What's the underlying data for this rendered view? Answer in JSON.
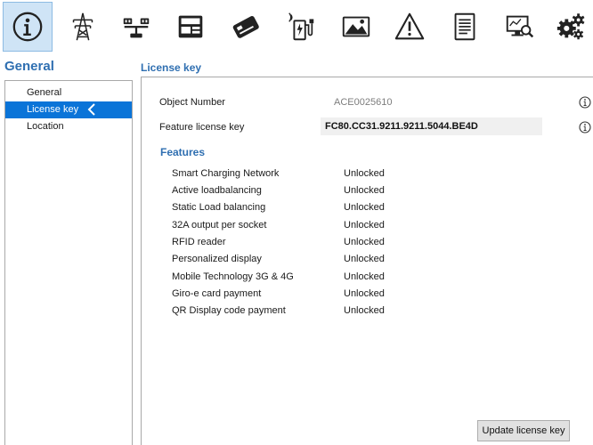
{
  "toolbar": {
    "items": [
      {
        "icon": "info-circle-icon",
        "active": true
      },
      {
        "icon": "power-tower-icon"
      },
      {
        "icon": "load-balance-icon"
      },
      {
        "icon": "card-payment-icon"
      },
      {
        "icon": "rfid-card-icon"
      },
      {
        "icon": "charging-station-icon"
      },
      {
        "icon": "display-image-icon"
      },
      {
        "icon": "warning-icon"
      },
      {
        "icon": "document-icon"
      },
      {
        "icon": "diagnostics-monitor-icon"
      },
      {
        "icon": "settings-gears-icon"
      }
    ]
  },
  "sidebar": {
    "title": "General",
    "items": [
      {
        "label": "General"
      },
      {
        "label": "License key",
        "selected": true
      },
      {
        "label": "Location"
      }
    ]
  },
  "panel": {
    "title": "License key",
    "object_number_label": "Object Number",
    "object_number_value": "ACE0025610",
    "feature_key_label": "Feature license key",
    "feature_key_value": "FC80.CC31.9211.9211.5044.BE4D",
    "features_title": "Features",
    "features": [
      {
        "name": "Smart Charging Network",
        "status": "Unlocked"
      },
      {
        "name": "Active loadbalancing",
        "status": "Unlocked"
      },
      {
        "name": "Static Load balancing",
        "status": "Unlocked"
      },
      {
        "name": "32A output per socket",
        "status": "Unlocked"
      },
      {
        "name": "RFID reader",
        "status": "Unlocked"
      },
      {
        "name": "Personalized display",
        "status": "Unlocked"
      },
      {
        "name": "Mobile Technology 3G & 4G",
        "status": "Unlocked"
      },
      {
        "name": "Giro-e card payment",
        "status": "Unlocked"
      },
      {
        "name": "QR Display code payment",
        "status": "Unlocked"
      }
    ],
    "update_button": "Update license key"
  },
  "colors": {
    "accent": "#2f6fb1",
    "selection": "#0a74d8",
    "active_tool_bg": "#cfe4f6"
  }
}
